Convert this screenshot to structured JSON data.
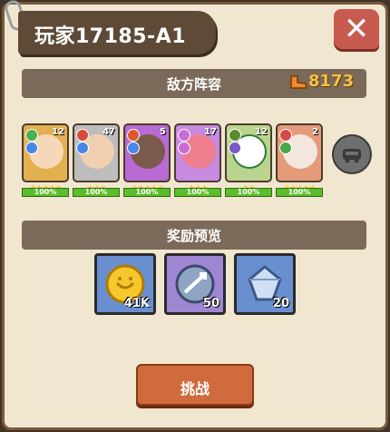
{
  "title": "玩家17185-A1",
  "close_label": "✕",
  "enemy_section": {
    "label": "敌方阵容",
    "power_value": "8173",
    "power_icon": "boot-icon"
  },
  "heroes": [
    {
      "level": "12",
      "stars": "★★★★★",
      "hp_percent": "100%",
      "theme": "#e3b04f"
    },
    {
      "level": "47",
      "stars": "★★★",
      "hp_percent": "100%",
      "theme": "#bdbdbd"
    },
    {
      "level": "5",
      "stars": "★★★★★",
      "hp_percent": "100%",
      "theme": "#b96ad3"
    },
    {
      "level": "17",
      "stars": "★★★",
      "hp_percent": "100%",
      "theme": "#c68ae0"
    },
    {
      "level": "12",
      "stars": "★★",
      "hp_percent": "100%",
      "theme": "#b9d48e"
    },
    {
      "level": "2",
      "stars": "★★★★★",
      "hp_percent": "100%",
      "theme": "#e59a7a"
    }
  ],
  "reward_section": {
    "label": "奖励预览",
    "items": [
      {
        "amount": "41K",
        "icon": "gold-coin-icon",
        "bg": "#6a8fd0"
      },
      {
        "amount": "50",
        "icon": "arrow-emblem-icon",
        "bg": "#9f86d3"
      },
      {
        "amount": "20",
        "icon": "crystal-icon",
        "bg": "#6a8fd0"
      }
    ]
  },
  "fight_button": "挑战"
}
